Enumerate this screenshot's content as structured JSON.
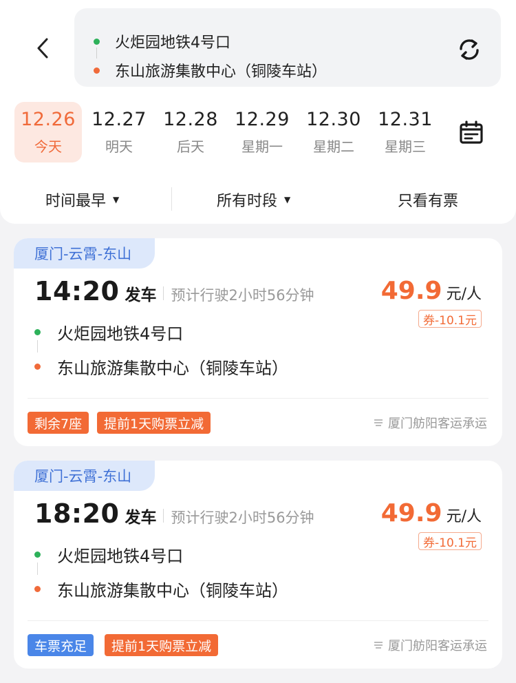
{
  "route": {
    "from": "火炬园地铁4号口",
    "to": "东山旅游集散中心（铜陵车站）",
    "from_dot_color": "#2db15a",
    "to_dot_color": "#f06a3a"
  },
  "dates": [
    {
      "date": "12.26",
      "label": "今天",
      "selected": true
    },
    {
      "date": "12.27",
      "label": "明天",
      "selected": false
    },
    {
      "date": "12.28",
      "label": "后天",
      "selected": false
    },
    {
      "date": "12.29",
      "label": "星期一",
      "selected": false
    },
    {
      "date": "12.30",
      "label": "星期二",
      "selected": false
    },
    {
      "date": "12.31",
      "label": "星期三",
      "selected": false
    }
  ],
  "filters": {
    "sort": "时间最早",
    "period": "所有时段",
    "available_only": "只看有票"
  },
  "trips": [
    {
      "line": "厦门-云霄-东山",
      "depart_time": "14:20",
      "depart_label": "发车",
      "duration": "预计行驶2小时56分钟",
      "price": "49.9",
      "price_unit": "元/人",
      "coupon": "券-10.1元",
      "from": "火炬园地铁4号口",
      "to": "东山旅游集散中心（铜陵车站）",
      "badges": [
        {
          "text": "剩余7座",
          "color": "#f26a35"
        },
        {
          "text": "提前1天购票立减",
          "color": "#f26a35"
        }
      ],
      "operator": "厦门舫阳客运承运"
    },
    {
      "line": "厦门-云霄-东山",
      "depart_time": "18:20",
      "depart_label": "发车",
      "duration": "预计行驶2小时56分钟",
      "price": "49.9",
      "price_unit": "元/人",
      "coupon": "券-10.1元",
      "from": "火炬园地铁4号口",
      "to": "东山旅游集散中心（铜陵车站）",
      "badges": [
        {
          "text": "车票充足",
          "color": "#4a86e8"
        },
        {
          "text": "提前1天购票立减",
          "color": "#f26a35"
        }
      ],
      "operator": "厦门舫阳客运承运"
    }
  ],
  "icons": {
    "back": "chevron-left-icon",
    "swap": "refresh-icon",
    "calendar": "calendar-icon",
    "dropdown": "caret-down-icon",
    "operator": "operator-logo-icon"
  },
  "colors": {
    "accent": "#f26a35",
    "line_tag_bg": "#dde8fb",
    "line_tag_text": "#3f71d6"
  }
}
